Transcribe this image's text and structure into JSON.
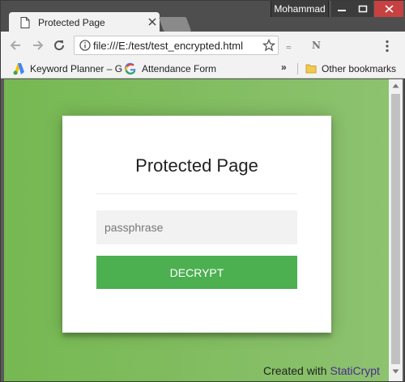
{
  "window": {
    "profile_name": "Mohammad"
  },
  "tab": {
    "title": "Protected Page"
  },
  "toolbar": {
    "url": "file:///E:/test/test_encrypted.html",
    "extension_label": "N"
  },
  "bookmarks": {
    "items": [
      {
        "label": "Keyword Planner – G",
        "icon": "google-ads-icon"
      },
      {
        "label": "Attendance Form",
        "icon": "google-g-icon"
      }
    ],
    "overflow": "»",
    "other": "Other bookmarks"
  },
  "page": {
    "heading": "Protected Page",
    "passphrase_placeholder": "passphrase",
    "decrypt_label": "DECRYPT",
    "footer_prefix": "Created with",
    "footer_link": "StatiCrypt"
  },
  "colors": {
    "accent": "#4caf50",
    "background_start": "#76b852",
    "background_end": "#8dc26f",
    "link": "#4a2a90"
  }
}
